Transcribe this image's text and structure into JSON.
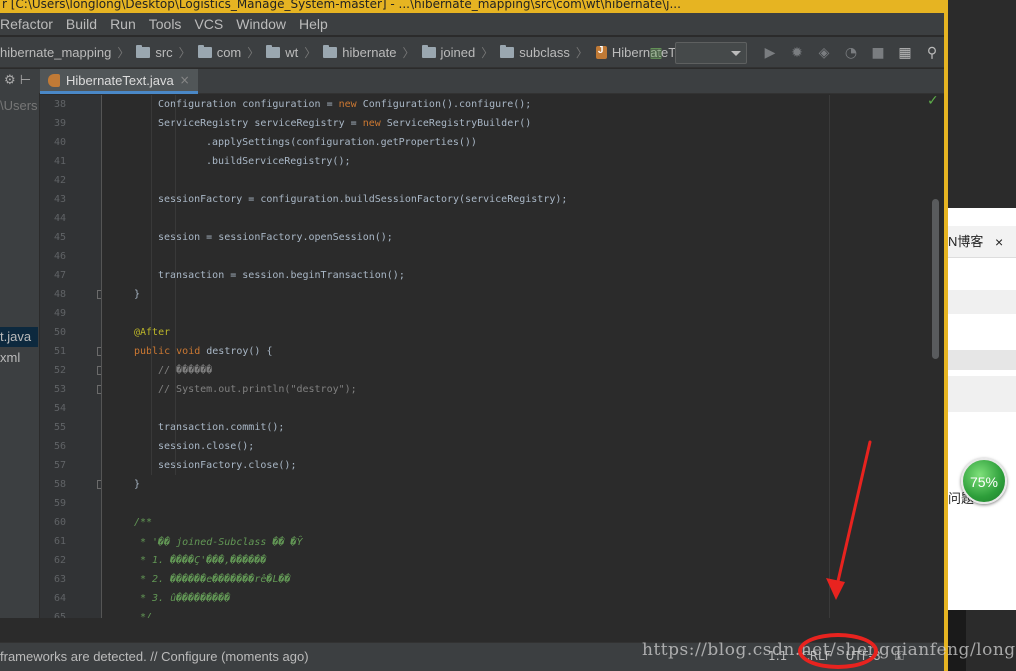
{
  "window": {
    "title": "r [C:\\Users\\longlong\\Desktop\\Logistics_Manage_System-master] - ...\\hibernate_mapping\\src\\com\\wt\\hibernate\\j..."
  },
  "menu": [
    "Refactor",
    "Build",
    "Run",
    "Tools",
    "VCS",
    "Window",
    "Help"
  ],
  "breadcrumb": [
    "hibernate_mapping",
    "src",
    "com",
    "wt",
    "hibernate",
    "joined",
    "subclass",
    "HibernateText.java"
  ],
  "project_pane": {
    "path_fragment": "\\Users",
    "items": [
      "t.java",
      "xml"
    ]
  },
  "editor": {
    "active_tab": "HibernateText.java",
    "close_glyph": "×",
    "lines": [
      {
        "n": "38",
        "text": "Configuration configuration = new Configuration().configure();"
      },
      {
        "n": "39",
        "text": "ServiceRegistry serviceRegistry = new ServiceRegistryBuilder()"
      },
      {
        "n": "40",
        "text": ".applySettings(configuration.getProperties())"
      },
      {
        "n": "41",
        "text": ".buildServiceRegistry();"
      },
      {
        "n": "42",
        "text": ""
      },
      {
        "n": "43",
        "text": "sessionFactory = configuration.buildSessionFactory(serviceRegistry);"
      },
      {
        "n": "44",
        "text": ""
      },
      {
        "n": "45",
        "text": "session = sessionFactory.openSession();"
      },
      {
        "n": "46",
        "text": ""
      },
      {
        "n": "47",
        "text": "transaction = session.beginTransaction();"
      },
      {
        "n": "48",
        "text": "}"
      },
      {
        "n": "49",
        "text": ""
      },
      {
        "n": "50",
        "text": "@After"
      },
      {
        "n": "51",
        "text": "public void destroy() {"
      },
      {
        "n": "52",
        "text": "// ������"
      },
      {
        "n": "53",
        "text": "// System.out.println(\"destroy\");"
      },
      {
        "n": "54",
        "text": ""
      },
      {
        "n": "55",
        "text": "transaction.commit();"
      },
      {
        "n": "56",
        "text": "session.close();"
      },
      {
        "n": "57",
        "text": "sessionFactory.close();"
      },
      {
        "n": "58",
        "text": "}"
      },
      {
        "n": "59",
        "text": ""
      },
      {
        "n": "60",
        "text": "/**"
      },
      {
        "n": "61",
        "text": "* '�� joined-Subclass �� �Ŷ"
      },
      {
        "n": "62",
        "text": "* 1. ����Ç'���,������"
      },
      {
        "n": "63",
        "text": "* 2. ������e�������rê�L��"
      },
      {
        "n": "64",
        "text": "* 3. û���������"
      },
      {
        "n": "65",
        "text": "*/"
      }
    ]
  },
  "status": {
    "message": "frameworks are detected. // Configure (moments ago)",
    "position": "1:1",
    "line_sep": "CRLF",
    "encoding": "UTF-8"
  },
  "watermark": "https://blog.csdn.net/shengqianfeng/long",
  "background_app": {
    "tab_label": "N博客",
    "close_glyph": "×",
    "speed_percent": "75%",
    "text_fragment": "问题"
  },
  "colors": {
    "window_border": "#e6b422",
    "annotation_red": "#e8231f",
    "keyword": "#cc7832",
    "doc_comment": "#629755"
  }
}
